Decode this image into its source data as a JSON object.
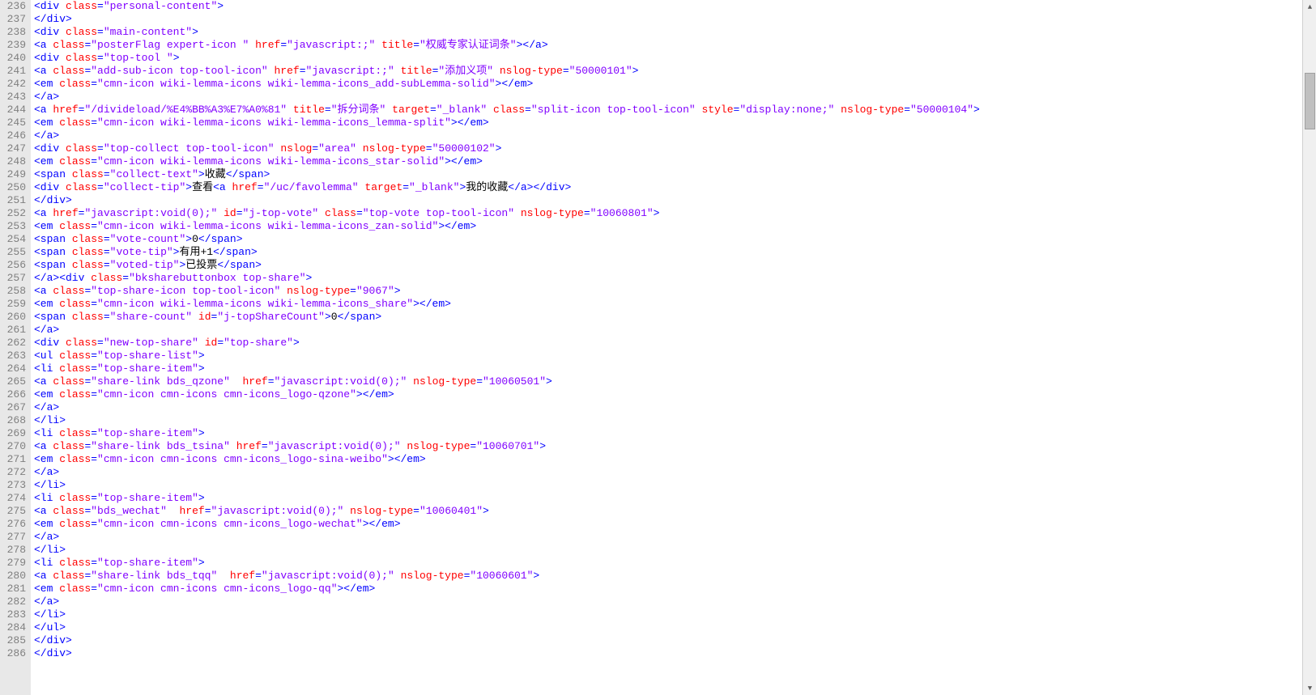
{
  "firstLineNumber": 236,
  "lines": [
    [
      [
        "tag",
        "<div"
      ],
      [
        "text",
        " "
      ],
      [
        "attr-name",
        "class"
      ],
      [
        "tag",
        "="
      ],
      [
        "attr-val",
        "\"personal-content\""
      ],
      [
        "tag",
        ">"
      ]
    ],
    [
      [
        "tag",
        "</div>"
      ]
    ],
    [
      [
        "tag",
        "<div"
      ],
      [
        "text",
        " "
      ],
      [
        "attr-name",
        "class"
      ],
      [
        "tag",
        "="
      ],
      [
        "attr-val",
        "\"main-content\""
      ],
      [
        "tag",
        ">"
      ]
    ],
    [
      [
        "tag",
        "<a"
      ],
      [
        "text",
        " "
      ],
      [
        "attr-name",
        "class"
      ],
      [
        "tag",
        "="
      ],
      [
        "attr-val",
        "\"posterFlag expert-icon \""
      ],
      [
        "text",
        " "
      ],
      [
        "attr-name",
        "href"
      ],
      [
        "tag",
        "="
      ],
      [
        "attr-val",
        "\"javascript:;\""
      ],
      [
        "text",
        " "
      ],
      [
        "attr-name",
        "title"
      ],
      [
        "tag",
        "="
      ],
      [
        "attr-val",
        "\"权威专家认证词条\""
      ],
      [
        "tag",
        "></a>"
      ]
    ],
    [
      [
        "tag",
        "<div"
      ],
      [
        "text",
        " "
      ],
      [
        "attr-name",
        "class"
      ],
      [
        "tag",
        "="
      ],
      [
        "attr-val",
        "\"top-tool \""
      ],
      [
        "tag",
        ">"
      ]
    ],
    [
      [
        "tag",
        "<a"
      ],
      [
        "text",
        " "
      ],
      [
        "attr-name",
        "class"
      ],
      [
        "tag",
        "="
      ],
      [
        "attr-val",
        "\"add-sub-icon top-tool-icon\""
      ],
      [
        "text",
        " "
      ],
      [
        "attr-name",
        "href"
      ],
      [
        "tag",
        "="
      ],
      [
        "attr-val",
        "\"javascript:;\""
      ],
      [
        "text",
        " "
      ],
      [
        "attr-name",
        "title"
      ],
      [
        "tag",
        "="
      ],
      [
        "attr-val",
        "\"添加义项\""
      ],
      [
        "text",
        " "
      ],
      [
        "attr-name",
        "nslog-type"
      ],
      [
        "tag",
        "="
      ],
      [
        "attr-val",
        "\"50000101\""
      ],
      [
        "tag",
        ">"
      ]
    ],
    [
      [
        "tag",
        "<em"
      ],
      [
        "text",
        " "
      ],
      [
        "attr-name",
        "class"
      ],
      [
        "tag",
        "="
      ],
      [
        "attr-val",
        "\"cmn-icon wiki-lemma-icons wiki-lemma-icons_add-subLemma-solid\""
      ],
      [
        "tag",
        "></em>"
      ]
    ],
    [
      [
        "tag",
        "</a>"
      ]
    ],
    [
      [
        "tag",
        "<a"
      ],
      [
        "text",
        " "
      ],
      [
        "attr-name",
        "href"
      ],
      [
        "tag",
        "="
      ],
      [
        "attr-val",
        "\"/divideload/%E4%BB%A3%E7%A0%81\""
      ],
      [
        "text",
        " "
      ],
      [
        "attr-name",
        "title"
      ],
      [
        "tag",
        "="
      ],
      [
        "attr-val",
        "\"拆分词条\""
      ],
      [
        "text",
        " "
      ],
      [
        "attr-name",
        "target"
      ],
      [
        "tag",
        "="
      ],
      [
        "attr-val",
        "\"_blank\""
      ],
      [
        "text",
        " "
      ],
      [
        "attr-name",
        "class"
      ],
      [
        "tag",
        "="
      ],
      [
        "attr-val",
        "\"split-icon top-tool-icon\""
      ],
      [
        "text",
        " "
      ],
      [
        "attr-name",
        "style"
      ],
      [
        "tag",
        "="
      ],
      [
        "attr-val",
        "\"display:none;\""
      ],
      [
        "text",
        " "
      ],
      [
        "attr-name",
        "nslog-type"
      ],
      [
        "tag",
        "="
      ],
      [
        "attr-val",
        "\"50000104\""
      ],
      [
        "tag",
        ">"
      ]
    ],
    [
      [
        "tag",
        "<em"
      ],
      [
        "text",
        " "
      ],
      [
        "attr-name",
        "class"
      ],
      [
        "tag",
        "="
      ],
      [
        "attr-val",
        "\"cmn-icon wiki-lemma-icons wiki-lemma-icons_lemma-split\""
      ],
      [
        "tag",
        "></em>"
      ]
    ],
    [
      [
        "tag",
        "</a>"
      ]
    ],
    [
      [
        "tag",
        "<div"
      ],
      [
        "text",
        " "
      ],
      [
        "attr-name",
        "class"
      ],
      [
        "tag",
        "="
      ],
      [
        "attr-val",
        "\"top-collect top-tool-icon\""
      ],
      [
        "text",
        " "
      ],
      [
        "attr-name",
        "nslog"
      ],
      [
        "tag",
        "="
      ],
      [
        "attr-val",
        "\"area\""
      ],
      [
        "text",
        " "
      ],
      [
        "attr-name",
        "nslog-type"
      ],
      [
        "tag",
        "="
      ],
      [
        "attr-val",
        "\"50000102\""
      ],
      [
        "tag",
        ">"
      ]
    ],
    [
      [
        "tag",
        "<em"
      ],
      [
        "text",
        " "
      ],
      [
        "attr-name",
        "class"
      ],
      [
        "tag",
        "="
      ],
      [
        "attr-val",
        "\"cmn-icon wiki-lemma-icons wiki-lemma-icons_star-solid\""
      ],
      [
        "tag",
        "></em>"
      ]
    ],
    [
      [
        "tag",
        "<span"
      ],
      [
        "text",
        " "
      ],
      [
        "attr-name",
        "class"
      ],
      [
        "tag",
        "="
      ],
      [
        "attr-val",
        "\"collect-text\""
      ],
      [
        "tag",
        ">"
      ],
      [
        "text",
        "收藏"
      ],
      [
        "tag",
        "</span>"
      ]
    ],
    [
      [
        "tag",
        "<div"
      ],
      [
        "text",
        " "
      ],
      [
        "attr-name",
        "class"
      ],
      [
        "tag",
        "="
      ],
      [
        "attr-val",
        "\"collect-tip\""
      ],
      [
        "tag",
        ">"
      ],
      [
        "text",
        "查看"
      ],
      [
        "tag",
        "<a"
      ],
      [
        "text",
        " "
      ],
      [
        "attr-name",
        "href"
      ],
      [
        "tag",
        "="
      ],
      [
        "attr-val",
        "\"/uc/favolemma\""
      ],
      [
        "text",
        " "
      ],
      [
        "attr-name",
        "target"
      ],
      [
        "tag",
        "="
      ],
      [
        "attr-val",
        "\"_blank\""
      ],
      [
        "tag",
        ">"
      ],
      [
        "text",
        "我的收藏"
      ],
      [
        "tag",
        "</a></div>"
      ]
    ],
    [
      [
        "tag",
        "</div>"
      ]
    ],
    [
      [
        "tag",
        "<a"
      ],
      [
        "text",
        " "
      ],
      [
        "attr-name",
        "href"
      ],
      [
        "tag",
        "="
      ],
      [
        "attr-val",
        "\"javascript:void(0);\""
      ],
      [
        "text",
        " "
      ],
      [
        "attr-name",
        "id"
      ],
      [
        "tag",
        "="
      ],
      [
        "attr-val",
        "\"j-top-vote\""
      ],
      [
        "text",
        " "
      ],
      [
        "attr-name",
        "class"
      ],
      [
        "tag",
        "="
      ],
      [
        "attr-val",
        "\"top-vote top-tool-icon\""
      ],
      [
        "text",
        " "
      ],
      [
        "attr-name",
        "nslog-type"
      ],
      [
        "tag",
        "="
      ],
      [
        "attr-val",
        "\"10060801\""
      ],
      [
        "tag",
        ">"
      ]
    ],
    [
      [
        "tag",
        "<em"
      ],
      [
        "text",
        " "
      ],
      [
        "attr-name",
        "class"
      ],
      [
        "tag",
        "="
      ],
      [
        "attr-val",
        "\"cmn-icon wiki-lemma-icons wiki-lemma-icons_zan-solid\""
      ],
      [
        "tag",
        "></em>"
      ]
    ],
    [
      [
        "tag",
        "<span"
      ],
      [
        "text",
        " "
      ],
      [
        "attr-name",
        "class"
      ],
      [
        "tag",
        "="
      ],
      [
        "attr-val",
        "\"vote-count\""
      ],
      [
        "tag",
        ">"
      ],
      [
        "text",
        "0"
      ],
      [
        "tag",
        "</span>"
      ]
    ],
    [
      [
        "tag",
        "<span"
      ],
      [
        "text",
        " "
      ],
      [
        "attr-name",
        "class"
      ],
      [
        "tag",
        "="
      ],
      [
        "attr-val",
        "\"vote-tip\""
      ],
      [
        "tag",
        ">"
      ],
      [
        "text",
        "有用+1"
      ],
      [
        "tag",
        "</span>"
      ]
    ],
    [
      [
        "tag",
        "<span"
      ],
      [
        "text",
        " "
      ],
      [
        "attr-name",
        "class"
      ],
      [
        "tag",
        "="
      ],
      [
        "attr-val",
        "\"voted-tip\""
      ],
      [
        "tag",
        ">"
      ],
      [
        "text",
        "已投票"
      ],
      [
        "tag",
        "</span>"
      ]
    ],
    [
      [
        "tag",
        "</a><div"
      ],
      [
        "text",
        " "
      ],
      [
        "attr-name",
        "class"
      ],
      [
        "tag",
        "="
      ],
      [
        "attr-val",
        "\"bksharebuttonbox top-share\""
      ],
      [
        "tag",
        ">"
      ]
    ],
    [
      [
        "tag",
        "<a"
      ],
      [
        "text",
        " "
      ],
      [
        "attr-name",
        "class"
      ],
      [
        "tag",
        "="
      ],
      [
        "attr-val",
        "\"top-share-icon top-tool-icon\""
      ],
      [
        "text",
        " "
      ],
      [
        "attr-name",
        "nslog-type"
      ],
      [
        "tag",
        "="
      ],
      [
        "attr-val",
        "\"9067\""
      ],
      [
        "tag",
        ">"
      ]
    ],
    [
      [
        "tag",
        "<em"
      ],
      [
        "text",
        " "
      ],
      [
        "attr-name",
        "class"
      ],
      [
        "tag",
        "="
      ],
      [
        "attr-val",
        "\"cmn-icon wiki-lemma-icons wiki-lemma-icons_share\""
      ],
      [
        "tag",
        "></em>"
      ]
    ],
    [
      [
        "tag",
        "<span"
      ],
      [
        "text",
        " "
      ],
      [
        "attr-name",
        "class"
      ],
      [
        "tag",
        "="
      ],
      [
        "attr-val",
        "\"share-count\""
      ],
      [
        "text",
        " "
      ],
      [
        "attr-name",
        "id"
      ],
      [
        "tag",
        "="
      ],
      [
        "attr-val",
        "\"j-topShareCount\""
      ],
      [
        "tag",
        ">"
      ],
      [
        "text",
        "0"
      ],
      [
        "tag",
        "</span>"
      ]
    ],
    [
      [
        "tag",
        "</a>"
      ]
    ],
    [
      [
        "tag",
        "<div"
      ],
      [
        "text",
        " "
      ],
      [
        "attr-name",
        "class"
      ],
      [
        "tag",
        "="
      ],
      [
        "attr-val",
        "\"new-top-share\""
      ],
      [
        "text",
        " "
      ],
      [
        "attr-name",
        "id"
      ],
      [
        "tag",
        "="
      ],
      [
        "attr-val",
        "\"top-share\""
      ],
      [
        "tag",
        ">"
      ]
    ],
    [
      [
        "tag",
        "<ul"
      ],
      [
        "text",
        " "
      ],
      [
        "attr-name",
        "class"
      ],
      [
        "tag",
        "="
      ],
      [
        "attr-val",
        "\"top-share-list\""
      ],
      [
        "tag",
        ">"
      ]
    ],
    [
      [
        "tag",
        "<li"
      ],
      [
        "text",
        " "
      ],
      [
        "attr-name",
        "class"
      ],
      [
        "tag",
        "="
      ],
      [
        "attr-val",
        "\"top-share-item\""
      ],
      [
        "tag",
        ">"
      ]
    ],
    [
      [
        "tag",
        "<a"
      ],
      [
        "text",
        " "
      ],
      [
        "attr-name",
        "class"
      ],
      [
        "tag",
        "="
      ],
      [
        "attr-val",
        "\"share-link bds_qzone\""
      ],
      [
        "text",
        "  "
      ],
      [
        "attr-name",
        "href"
      ],
      [
        "tag",
        "="
      ],
      [
        "attr-val",
        "\"javascript:void(0);\""
      ],
      [
        "text",
        " "
      ],
      [
        "attr-name",
        "nslog-type"
      ],
      [
        "tag",
        "="
      ],
      [
        "attr-val",
        "\"10060501\""
      ],
      [
        "tag",
        ">"
      ]
    ],
    [
      [
        "tag",
        "<em"
      ],
      [
        "text",
        " "
      ],
      [
        "attr-name",
        "class"
      ],
      [
        "tag",
        "="
      ],
      [
        "attr-val",
        "\"cmn-icon cmn-icons cmn-icons_logo-qzone\""
      ],
      [
        "tag",
        "></em>"
      ]
    ],
    [
      [
        "tag",
        "</a>"
      ]
    ],
    [
      [
        "tag",
        "</li>"
      ]
    ],
    [
      [
        "tag",
        "<li"
      ],
      [
        "text",
        " "
      ],
      [
        "attr-name",
        "class"
      ],
      [
        "tag",
        "="
      ],
      [
        "attr-val",
        "\"top-share-item\""
      ],
      [
        "tag",
        ">"
      ]
    ],
    [
      [
        "tag",
        "<a"
      ],
      [
        "text",
        " "
      ],
      [
        "attr-name",
        "class"
      ],
      [
        "tag",
        "="
      ],
      [
        "attr-val",
        "\"share-link bds_tsina\""
      ],
      [
        "text",
        " "
      ],
      [
        "attr-name",
        "href"
      ],
      [
        "tag",
        "="
      ],
      [
        "attr-val",
        "\"javascript:void(0);\""
      ],
      [
        "text",
        " "
      ],
      [
        "attr-name",
        "nslog-type"
      ],
      [
        "tag",
        "="
      ],
      [
        "attr-val",
        "\"10060701\""
      ],
      [
        "tag",
        ">"
      ]
    ],
    [
      [
        "tag",
        "<em"
      ],
      [
        "text",
        " "
      ],
      [
        "attr-name",
        "class"
      ],
      [
        "tag",
        "="
      ],
      [
        "attr-val",
        "\"cmn-icon cmn-icons cmn-icons_logo-sina-weibo\""
      ],
      [
        "tag",
        "></em>"
      ]
    ],
    [
      [
        "tag",
        "</a>"
      ]
    ],
    [
      [
        "tag",
        "</li>"
      ]
    ],
    [
      [
        "tag",
        "<li"
      ],
      [
        "text",
        " "
      ],
      [
        "attr-name",
        "class"
      ],
      [
        "tag",
        "="
      ],
      [
        "attr-val",
        "\"top-share-item\""
      ],
      [
        "tag",
        ">"
      ]
    ],
    [
      [
        "tag",
        "<a"
      ],
      [
        "text",
        " "
      ],
      [
        "attr-name",
        "class"
      ],
      [
        "tag",
        "="
      ],
      [
        "attr-val",
        "\"bds_wechat\""
      ],
      [
        "text",
        "  "
      ],
      [
        "attr-name",
        "href"
      ],
      [
        "tag",
        "="
      ],
      [
        "attr-val",
        "\"javascript:void(0);\""
      ],
      [
        "text",
        " "
      ],
      [
        "attr-name",
        "nslog-type"
      ],
      [
        "tag",
        "="
      ],
      [
        "attr-val",
        "\"10060401\""
      ],
      [
        "tag",
        ">"
      ]
    ],
    [
      [
        "tag",
        "<em"
      ],
      [
        "text",
        " "
      ],
      [
        "attr-name",
        "class"
      ],
      [
        "tag",
        "="
      ],
      [
        "attr-val",
        "\"cmn-icon cmn-icons cmn-icons_logo-wechat\""
      ],
      [
        "tag",
        "></em>"
      ]
    ],
    [
      [
        "tag",
        "</a>"
      ]
    ],
    [
      [
        "tag",
        "</li>"
      ]
    ],
    [
      [
        "tag",
        "<li"
      ],
      [
        "text",
        " "
      ],
      [
        "attr-name",
        "class"
      ],
      [
        "tag",
        "="
      ],
      [
        "attr-val",
        "\"top-share-item\""
      ],
      [
        "tag",
        ">"
      ]
    ],
    [
      [
        "tag",
        "<a"
      ],
      [
        "text",
        " "
      ],
      [
        "attr-name",
        "class"
      ],
      [
        "tag",
        "="
      ],
      [
        "attr-val",
        "\"share-link bds_tqq\""
      ],
      [
        "text",
        "  "
      ],
      [
        "attr-name",
        "href"
      ],
      [
        "tag",
        "="
      ],
      [
        "attr-val",
        "\"javascript:void(0);\""
      ],
      [
        "text",
        " "
      ],
      [
        "attr-name",
        "nslog-type"
      ],
      [
        "tag",
        "="
      ],
      [
        "attr-val",
        "\"10060601\""
      ],
      [
        "tag",
        ">"
      ]
    ],
    [
      [
        "tag",
        "<em"
      ],
      [
        "text",
        " "
      ],
      [
        "attr-name",
        "class"
      ],
      [
        "tag",
        "="
      ],
      [
        "attr-val",
        "\"cmn-icon cmn-icons cmn-icons_logo-qq\""
      ],
      [
        "tag",
        "></em>"
      ]
    ],
    [
      [
        "tag",
        "</a>"
      ]
    ],
    [
      [
        "tag",
        "</li>"
      ]
    ],
    [
      [
        "tag",
        "</ul>"
      ]
    ],
    [
      [
        "tag",
        "</div>"
      ]
    ],
    [
      [
        "tag",
        "</div>"
      ]
    ]
  ],
  "scrollbar": {
    "thumbTop": 90,
    "thumbHeight": 70
  }
}
